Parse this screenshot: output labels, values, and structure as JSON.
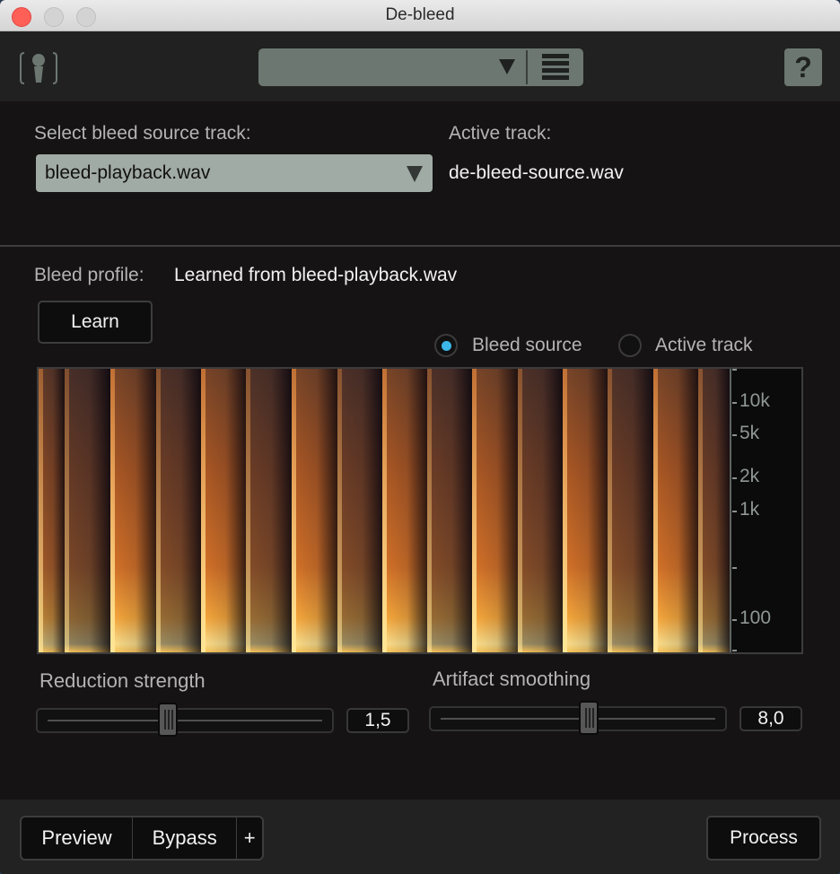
{
  "window": {
    "title": "De-bleed"
  },
  "header": {
    "logo_icon": "microphone-icon",
    "preset_value": "",
    "preset_arrow_icon": "triangle-down-icon",
    "preset_menu_icon": "list-icon",
    "help_label": "?"
  },
  "source": {
    "select_label": "Select bleed source track:",
    "select_value": "bleed-playback.wav",
    "active_label": "Active track:",
    "active_value": "de-bleed-source.wav"
  },
  "profile": {
    "label": "Bleed profile:",
    "value": "Learned from bleed-playback.wav",
    "learn_button": "Learn",
    "view_options": [
      {
        "label": "Bleed source",
        "selected": true
      },
      {
        "label": "Active track",
        "selected": false
      }
    ],
    "accent_color": "#3cb6e7"
  },
  "spectrogram": {
    "freq_axis_labels": [
      "10k",
      "5k",
      "2k",
      "1k",
      "100"
    ],
    "bursts": [
      {
        "start": 0.0,
        "strength": 0.75
      },
      {
        "start": 0.038,
        "strength": 0.55
      },
      {
        "start": 0.104,
        "strength": 1.0
      },
      {
        "start": 0.17,
        "strength": 0.6
      },
      {
        "start": 0.235,
        "strength": 1.0
      },
      {
        "start": 0.3,
        "strength": 0.6
      },
      {
        "start": 0.366,
        "strength": 1.0
      },
      {
        "start": 0.432,
        "strength": 0.6
      },
      {
        "start": 0.497,
        "strength": 1.0
      },
      {
        "start": 0.562,
        "strength": 0.6
      },
      {
        "start": 0.627,
        "strength": 1.0
      },
      {
        "start": 0.694,
        "strength": 0.6
      },
      {
        "start": 0.759,
        "strength": 1.0
      },
      {
        "start": 0.824,
        "strength": 0.6
      },
      {
        "start": 0.889,
        "strength": 1.0
      },
      {
        "start": 0.955,
        "strength": 0.6
      }
    ]
  },
  "controls": {
    "reduction": {
      "label": "Reduction strength",
      "value": "1,5",
      "position": 0.44
    },
    "smoothing": {
      "label": "Artifact smoothing",
      "value": "8,0",
      "position": 0.54
    }
  },
  "footer": {
    "preview": "Preview",
    "bypass": "Bypass",
    "plus": "+",
    "process": "Process"
  }
}
